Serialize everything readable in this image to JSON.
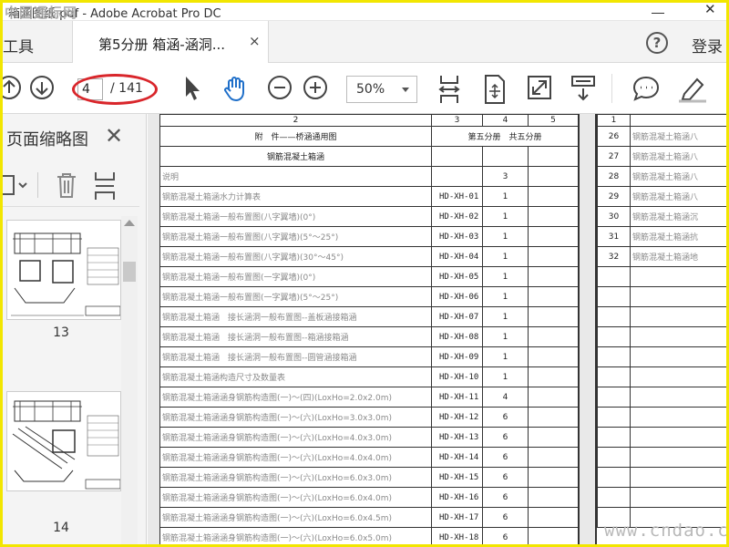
{
  "window": {
    "title": "箱涵图纸.pdf - Adobe Acrobat Pro DC",
    "watermark": "中国通标网"
  },
  "tabs": {
    "tools_label": "工具",
    "doc_tab_label": "第5分册 箱涵-涵洞...",
    "close_symbol": "×",
    "help_symbol": "?",
    "login_label": "登录"
  },
  "toolbar": {
    "current_page": "4",
    "total_pages": "/ 141",
    "zoom": "50%",
    "icons": [
      "prev-page-icon",
      "next-page-icon",
      "select-arrow-icon",
      "hand-tool-icon",
      "zoom-out-icon",
      "zoom-in-icon",
      "fit-width-icon",
      "fit-page-icon",
      "full-screen-icon",
      "scroll-mode-icon",
      "comment-icon",
      "highlight-pen-icon"
    ]
  },
  "sidebar": {
    "title": "页面缩略图",
    "close_symbol": "✕",
    "thumbnails": [
      {
        "page": "13"
      },
      {
        "page": "14"
      }
    ]
  },
  "doc": {
    "col_numbers": [
      "2",
      "3",
      "4",
      "5"
    ],
    "header_left": "附　件——桥涵通用图",
    "header_right": "第五分册　共五分册",
    "section_title": "钢筋混凝土箱涵",
    "rows": [
      {
        "name": "说明",
        "code": "",
        "sheets": "3"
      },
      {
        "name": "钢筋混凝土箱涵水力计算表",
        "code": "HD-XH-01",
        "sheets": "1"
      },
      {
        "name": "钢筋混凝土箱涵一般布置图(八字翼墙)(0°)",
        "code": "HD-XH-02",
        "sheets": "1"
      },
      {
        "name": "钢筋混凝土箱涵一般布置图(八字翼墙)(5°～25°)",
        "code": "HD-XH-03",
        "sheets": "1"
      },
      {
        "name": "钢筋混凝土箱涵一般布置图(八字翼墙)(30°～45°)",
        "code": "HD-XH-04",
        "sheets": "1"
      },
      {
        "name": "钢筋混凝土箱涵一般布置图(一字翼墙)(0°)",
        "code": "HD-XH-05",
        "sheets": "1"
      },
      {
        "name": "钢筋混凝土箱涵一般布置图(一字翼墙)(5°～25°)",
        "code": "HD-XH-06",
        "sheets": "1"
      },
      {
        "name": "钢筋混凝土箱涵　接长涵洞一般布置图--盖板涵接箱涵",
        "code": "HD-XH-07",
        "sheets": "1"
      },
      {
        "name": "钢筋混凝土箱涵　接长涵洞一般布置图--箱涵接箱涵",
        "code": "HD-XH-08",
        "sheets": "1"
      },
      {
        "name": "钢筋混凝土箱涵　接长涵洞一般布置图--圆管涵接箱涵",
        "code": "HD-XH-09",
        "sheets": "1"
      },
      {
        "name": "钢筋混凝土箱涵构造尺寸及数量表",
        "code": "HD-XH-10",
        "sheets": "1"
      },
      {
        "name": "钢筋混凝土箱涵涵身钢筋构造图(一)～(四)(LoxHo=2.0x2.0m)",
        "code": "HD-XH-11",
        "sheets": "4"
      },
      {
        "name": "钢筋混凝土箱涵涵身钢筋构造图(一)～(六)(LoxHo=3.0x3.0m)",
        "code": "HD-XH-12",
        "sheets": "6"
      },
      {
        "name": "钢筋混凝土箱涵涵身钢筋构造图(一)～(六)(LoxHo=4.0x3.0m)",
        "code": "HD-XH-13",
        "sheets": "6"
      },
      {
        "name": "钢筋混凝土箱涵涵身钢筋构造图(一)～(六)(LoxHo=4.0x4.0m)",
        "code": "HD-XH-14",
        "sheets": "6"
      },
      {
        "name": "钢筋混凝土箱涵涵身钢筋构造图(一)～(六)(LoxHo=6.0x3.0m)",
        "code": "HD-XH-15",
        "sheets": "6"
      },
      {
        "name": "钢筋混凝土箱涵涵身钢筋构造图(一)～(六)(LoxHo=6.0x4.0m)",
        "code": "HD-XH-16",
        "sheets": "6"
      },
      {
        "name": "钢筋混凝土箱涵涵身钢筋构造图(一)～(六)(LoxHo=6.0x4.5m)",
        "code": "HD-XH-17",
        "sheets": "6"
      },
      {
        "name": "钢筋混凝土箱涵涵身钢筋构造图(一)～(六)(LoxHo=6.0x5.0m)",
        "code": "HD-XH-18",
        "sheets": "6"
      }
    ],
    "right_page": {
      "col_number": "1",
      "rows": [
        {
          "num": "26",
          "name": "钢筋混凝土箱涵八"
        },
        {
          "num": "27",
          "name": "钢筋混凝土箱涵八"
        },
        {
          "num": "28",
          "name": "钢筋混凝土箱涵八"
        },
        {
          "num": "29",
          "name": "钢筋混凝土箱涵八"
        },
        {
          "num": "30",
          "name": "钢筋混凝土箱涵沉"
        },
        {
          "num": "31",
          "name": "钢筋混凝土箱涵抗"
        },
        {
          "num": "32",
          "name": "钢筋混凝土箱涵地"
        }
      ]
    }
  },
  "bottom_watermark": "www.cndao.com"
}
